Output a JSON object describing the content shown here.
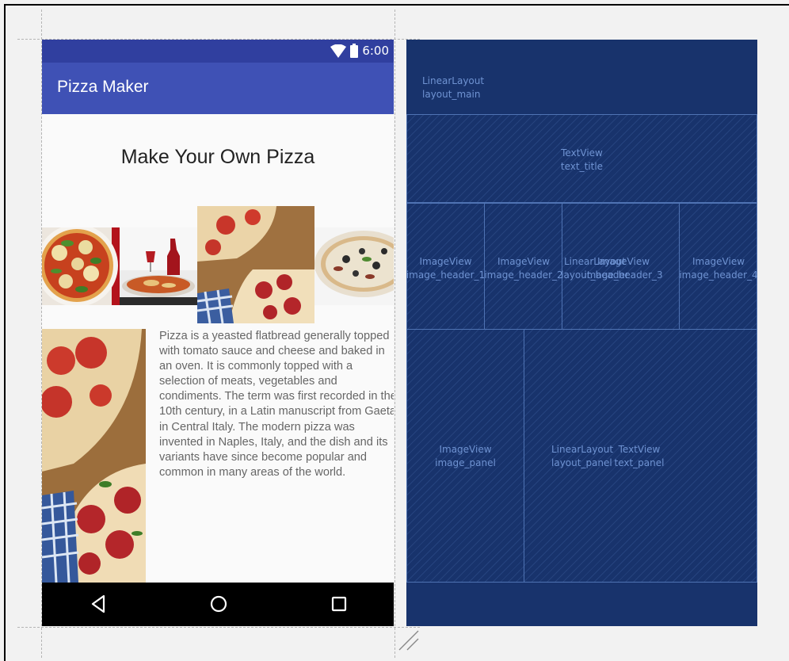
{
  "status_bar": {
    "time": "6:00",
    "icons": [
      "wifi-icon",
      "battery-icon"
    ]
  },
  "app_bar": {
    "title": "Pizza Maker"
  },
  "content": {
    "title": "Make Your Own Pizza",
    "panel_text": "Pizza is a yeasted flatbread generally topped with tomato sauce and cheese and baked in an oven. It is commonly topped with a selection of meats, vegetables and condiments. The term was first recorded in the 10th century, in a Latin manuscript from Gaeta in Central Italy. The modern pizza was invented in Naples, Italy, and the dish and its variants have since become popular and common in many areas of the world.",
    "header_images": [
      "pizza-photo-1",
      "pizza-photo-2",
      "pizza-photo-3",
      "pizza-photo-4"
    ],
    "panel_image": "pizza-photo-panel"
  },
  "nav_bar": {
    "buttons": [
      "back-icon",
      "home-icon",
      "recents-icon"
    ]
  },
  "blueprint": {
    "layout_main": {
      "type": "LinearLayout",
      "id": "layout_main"
    },
    "text_title": {
      "type": "TextView",
      "id": "text_title"
    },
    "image_header_1": {
      "type": "ImageView",
      "id": "image_header_1"
    },
    "image_header_2": {
      "type": "ImageView",
      "id": "image_header_2"
    },
    "image_header_3": {
      "type": "ImageView",
      "id": "image_header_3"
    },
    "image_header_4": {
      "type": "ImageView",
      "id": "image_header_4"
    },
    "layout_header": {
      "type": "LinearLayout",
      "id": "layout_header"
    },
    "image_panel": {
      "type": "ImageView",
      "id": "image_panel"
    },
    "layout_panel": {
      "type": "LinearLayout",
      "id": "layout_panel"
    },
    "text_panel": {
      "type": "TextView",
      "id": "text_panel"
    }
  },
  "colors": {
    "status_bar": "#303f9f",
    "app_bar": "#3f51b5",
    "blueprint_bg": "#18336c",
    "blueprint_line": "#4f73b3",
    "blueprint_text": "#6f93d2"
  }
}
